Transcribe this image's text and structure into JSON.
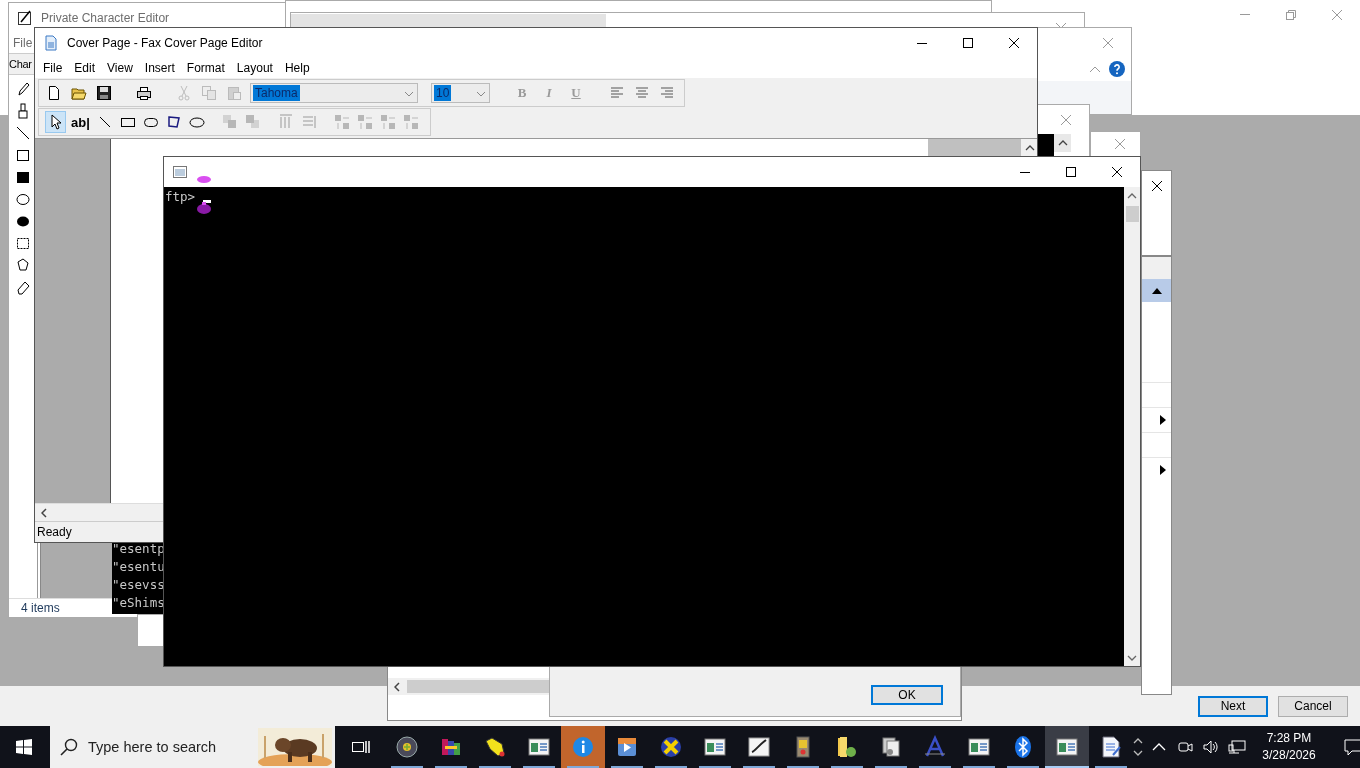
{
  "background_window": {
    "buttons": [
      {
        "label": "Next",
        "selected": true
      },
      {
        "label": "Cancel",
        "selected": false
      }
    ]
  },
  "char_editor": {
    "title": "Private Character Editor",
    "menu": [
      "File"
    ],
    "toolbar_label": "Char",
    "status": "4 items"
  },
  "cover_page": {
    "title": "Cover Page - Fax Cover Page Editor",
    "menu": [
      "File",
      "Edit",
      "View",
      "Insert",
      "Format",
      "Layout",
      "Help"
    ],
    "file_buttons": [
      {
        "kind": "new",
        "disabled": false
      },
      {
        "kind": "open",
        "disabled": false
      },
      {
        "kind": "save",
        "disabled": false
      },
      {
        "kind": "print",
        "disabled": false
      },
      {
        "kind": "cut",
        "disabled": true
      },
      {
        "kind": "copy",
        "disabled": true
      },
      {
        "kind": "paste",
        "disabled": true
      }
    ],
    "font": {
      "value": "Tahoma",
      "selected": true
    },
    "font_size": {
      "value": "10",
      "selected": true
    },
    "format_buttons": [
      {
        "label": "B",
        "disabled": true
      },
      {
        "label": "I",
        "disabled": true
      },
      {
        "label": "U",
        "disabled": true
      }
    ],
    "tools": [
      {
        "kind": "pointer",
        "selected": true,
        "disabled": false
      },
      {
        "kind": "text",
        "label": "ab|",
        "selected": false,
        "disabled": false
      },
      {
        "kind": "line",
        "selected": false,
        "disabled": false
      },
      {
        "kind": "rect",
        "selected": false,
        "disabled": false
      },
      {
        "kind": "roundrect",
        "selected": false,
        "disabled": false
      },
      {
        "kind": "polygon",
        "selected": false,
        "disabled": false
      },
      {
        "kind": "ellipse",
        "selected": false,
        "disabled": false
      },
      {
        "kind": "front",
        "selected": false,
        "disabled": true
      },
      {
        "kind": "back",
        "selected": false,
        "disabled": true
      },
      {
        "kind": "spacex",
        "selected": false,
        "disabled": true
      },
      {
        "kind": "spacey",
        "selected": false,
        "disabled": true
      },
      {
        "kind": "alignl",
        "selected": false,
        "disabled": true
      },
      {
        "kind": "alignr",
        "selected": false,
        "disabled": true
      },
      {
        "kind": "alignt",
        "selected": false,
        "disabled": true
      },
      {
        "kind": "alignb",
        "selected": false,
        "disabled": true
      }
    ],
    "status": "Ready"
  },
  "console_behind": {
    "lines": [
      "\"esentp",
      "\"esentu",
      "\"esevss",
      "\"eShims"
    ]
  },
  "ftp_console": {
    "prompt": "ftp>"
  },
  "dialog": {
    "button": "OK"
  },
  "taskbar": {
    "search_placeholder": "Type here to search",
    "apps": [
      {
        "kind": "globe",
        "running": true,
        "selected": false,
        "flashing": false
      },
      {
        "kind": "archive",
        "running": true,
        "selected": false,
        "flashing": false
      },
      {
        "kind": "hand",
        "running": true,
        "selected": false,
        "flashing": false
      },
      {
        "kind": "appwindow",
        "running": true,
        "selected": false,
        "flashing": false
      },
      {
        "kind": "info",
        "running": true,
        "selected": false,
        "flashing": true
      },
      {
        "kind": "media",
        "running": true,
        "selected": false,
        "flashing": false
      },
      {
        "kind": "xmark",
        "running": true,
        "selected": false,
        "flashing": false
      },
      {
        "kind": "appwindow",
        "running": true,
        "selected": false,
        "flashing": false
      },
      {
        "kind": "pen",
        "running": true,
        "selected": false,
        "flashing": false
      },
      {
        "kind": "book",
        "running": true,
        "selected": false,
        "flashing": false
      },
      {
        "kind": "folder",
        "running": true,
        "selected": false,
        "flashing": false
      },
      {
        "kind": "docs",
        "running": true,
        "selected": false,
        "flashing": false
      },
      {
        "kind": "font",
        "running": true,
        "selected": false,
        "flashing": false
      },
      {
        "kind": "appwindow",
        "running": true,
        "selected": false,
        "flashing": false
      },
      {
        "kind": "bluetooth",
        "running": true,
        "selected": false,
        "flashing": false
      },
      {
        "kind": "appwindow",
        "running": true,
        "selected": true,
        "flashing": false
      },
      {
        "kind": "notepad",
        "running": true,
        "selected": false,
        "flashing": false
      }
    ],
    "time": "7:28 PM",
    "date": "3/28/2026"
  }
}
